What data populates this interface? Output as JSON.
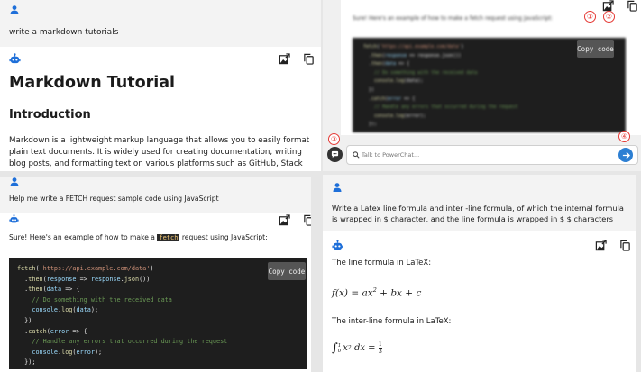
{
  "colors": {
    "accent": "#1e6fd9",
    "marker": "#e53935",
    "code_bg": "#1e1e1e",
    "send": "#2d7fd3"
  },
  "icons": {
    "user": "user-icon",
    "bot": "bot-icon",
    "export": "export-image-icon",
    "copy": "copy-icon",
    "send": "send-icon",
    "search": "search-icon",
    "chat": "chat-bubble-icon"
  },
  "panel1": {
    "user_message": "write a markdown tutorials",
    "heading1": "Markdown Tutorial",
    "heading2": "Introduction",
    "paragraph": "Markdown is a lightweight markup language that allows you to easily format plain text documents. It is widely used for creating documentation, writing blog posts, and formatting text on various platforms such as GitHub, Stack Overflow, and"
  },
  "panel2": {
    "user_message": "Help me write a FETCH request sample code using JavaScript",
    "intro_prefix": "Sure! Here's an example of how to make a ",
    "intro_code": "fetch",
    "intro_suffix": " request using JavaScript:",
    "copy_label": "Copy code",
    "code_lines": [
      [
        "fetch(",
        "'https://api.example.com/data'",
        ")"
      ],
      [
        "  .then(response => response.json())"
      ],
      [
        "  .then(data => {"
      ],
      [
        "    // Do something with the received data"
      ],
      [
        "    console.log(data);"
      ],
      [
        "  })"
      ],
      [
        "  .catch(error => {"
      ],
      [
        "    // Handle any errors that occurred during the request"
      ],
      [
        "    console.log(error);"
      ],
      [
        "  });"
      ]
    ]
  },
  "panel3": {
    "intro": "Sure! Here's an example of how to make a fetch request using JavaScript:",
    "copy_label": "Copy code",
    "placeholder": "Talk to PowerChat...",
    "markers": [
      "①",
      "②",
      "③",
      "④"
    ]
  },
  "panel4": {
    "user_message": "Write a Latex line formula and inter -line formula, of which the internal formula is wrapped in $ character, and the line formula is wrapped in $ $ characters",
    "line_label": "The line formula in LaTeX:",
    "inter_label": "The inter-line formula in LaTeX:"
  }
}
